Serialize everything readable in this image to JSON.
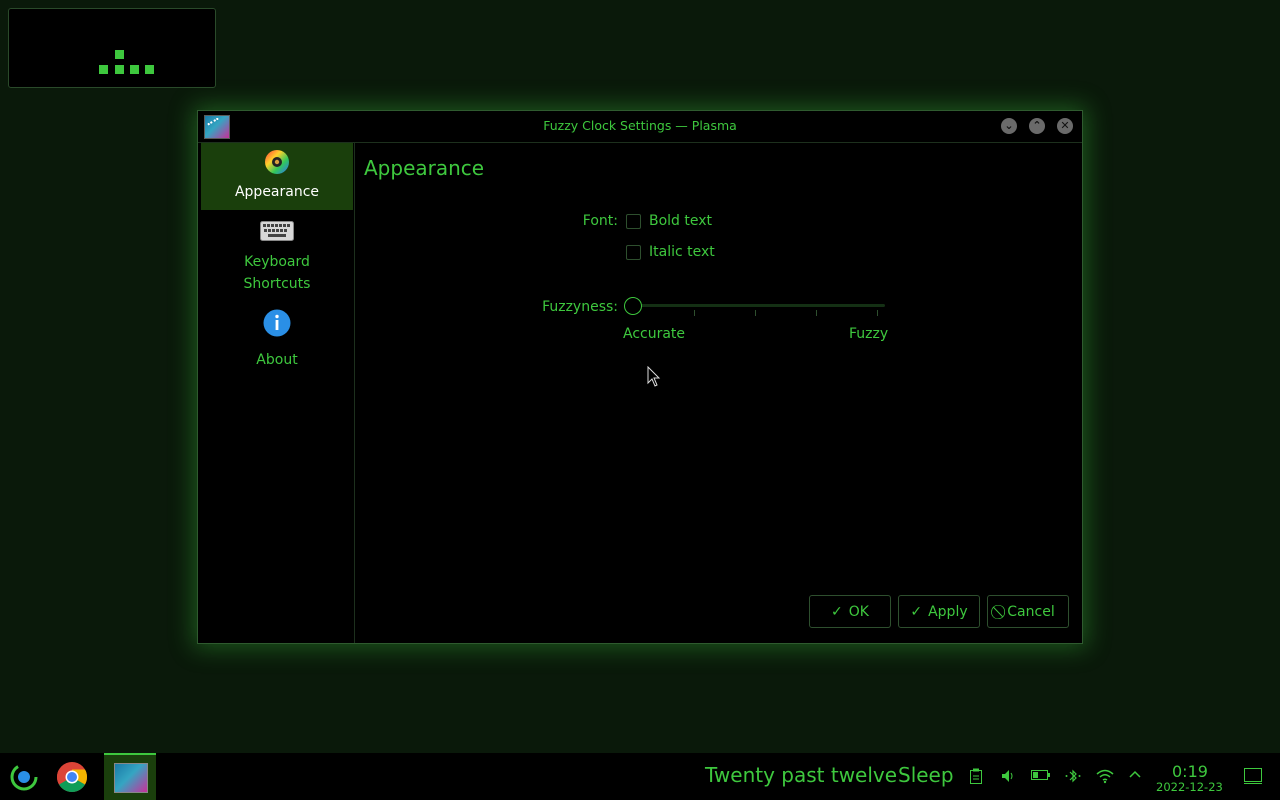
{
  "window": {
    "title": "Fuzzy Clock Settings — Plasma"
  },
  "sidebar": {
    "items": [
      {
        "label": "Appearance",
        "icon": "color-wheel-icon"
      },
      {
        "label": "Keyboard Shortcuts",
        "line1": "Keyboard",
        "line2": "Shortcuts",
        "icon": "keyboard-icon"
      },
      {
        "label": "About",
        "icon": "info-icon"
      }
    ]
  },
  "page": {
    "title": "Appearance",
    "font_label": "Font:",
    "bold_label": "Bold text",
    "italic_label": "Italic text",
    "bold_checked": false,
    "italic_checked": false,
    "fuzzyness_label": "Fuzzyness:",
    "slider_min_label": "Accurate",
    "slider_max_label": "Fuzzy",
    "slider_value_fraction": 0
  },
  "buttons": {
    "ok": "OK",
    "apply": "Apply",
    "cancel": "Cancel"
  },
  "taskbar": {
    "clock_text": "Twenty past twelve",
    "sleep_text": "Sleep",
    "time": "0:19",
    "date": "2022-12-23"
  },
  "colors": {
    "accent": "#3ec83e",
    "active_item_bg": "#1a3f0c",
    "background": "#000000"
  }
}
